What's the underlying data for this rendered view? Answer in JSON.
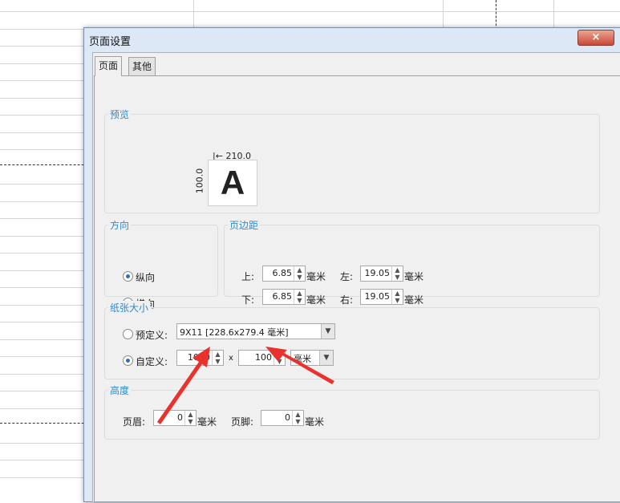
{
  "dialog": {
    "title": "页面设置",
    "close_glyph": "×",
    "tabs": [
      {
        "label": "页面"
      },
      {
        "label": "其他"
      }
    ]
  },
  "preview": {
    "group_label": "预览",
    "width_label": "210.0",
    "height_label": "100.0",
    "sample_letter": "A"
  },
  "orientation": {
    "group_label": "方向",
    "portrait": "纵向",
    "landscape": "横向",
    "selected": "portrait"
  },
  "margins": {
    "group_label": "页边距",
    "top_label": "上:",
    "top_value": "6.85",
    "left_label": "左:",
    "left_value": "19.05",
    "bottom_label": "下:",
    "bottom_value": "6.85",
    "right_label": "右:",
    "right_value": "19.05",
    "unit": "毫米"
  },
  "paper_size": {
    "group_label": "纸张大小",
    "predefined_label": "预定义:",
    "predefined_value": "9X11 [228.6x279.4 毫米]",
    "custom_label": "自定义:",
    "custom_width": "1000",
    "times": "x",
    "custom_height": "100",
    "unit": "毫米",
    "selected": "custom"
  },
  "height": {
    "group_label": "高度",
    "header_label": "页眉:",
    "header_value": "0",
    "footer_label": "页脚:",
    "footer_value": "0",
    "unit": "毫米"
  },
  "colors": {
    "group_label": "#2e8bcb",
    "annotation_arrow": "#e8322b",
    "radio_dot": "#2b6fc4"
  }
}
